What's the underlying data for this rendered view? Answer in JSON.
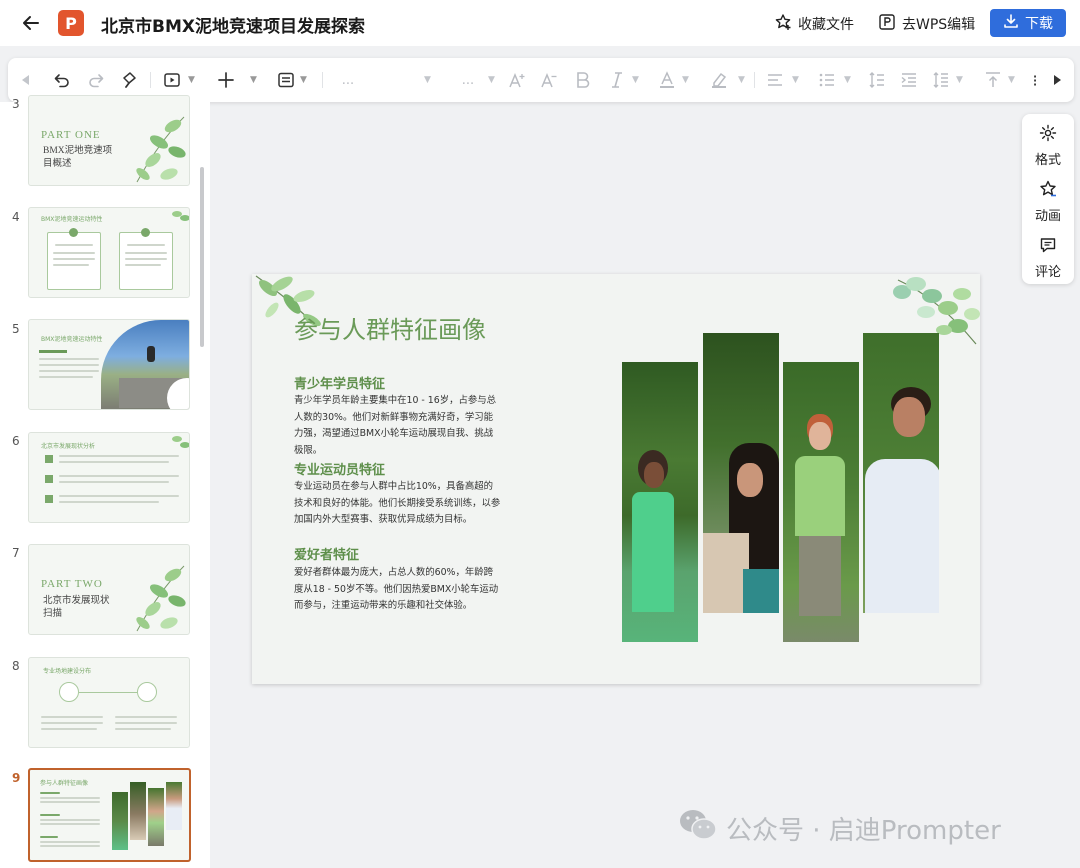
{
  "header": {
    "title": "北京市BMX泥地竞速项目发展探索",
    "app_logo_letter": "P",
    "favorite_label": "收藏文件",
    "wps_edit_label": "去WPS编辑",
    "download_label": "下载",
    "accent_color": "#2f6ddc"
  },
  "toolbar": {
    "font_name_placeholder": "...",
    "font_size_placeholder": "..."
  },
  "right_panel": {
    "format_label": "格式",
    "animation_label": "动画",
    "comment_label": "评论"
  },
  "thumbnails": [
    {
      "number": "3",
      "part_label": "PART ONE",
      "part_title": "BMX泥地竞速项目概述"
    },
    {
      "number": "4",
      "mini_title": "BMX泥地竞速运动特性"
    },
    {
      "number": "5",
      "mini_title": "BMX泥地竞速运动特性"
    },
    {
      "number": "6",
      "mini_title": "北京市发展现状分析"
    },
    {
      "number": "7",
      "part_label": "PART TWO",
      "part_title": "北京市发展现状扫描"
    },
    {
      "number": "8",
      "mini_title": "专业场地建设分布"
    },
    {
      "number": "9",
      "mini_title": "参与人群特征画像",
      "active": true
    }
  ],
  "slide": {
    "title": "参与人群特征画像",
    "sections": [
      {
        "heading": "青少年学员特征",
        "body": "青少年学员年龄主要集中在10 - 16岁，占参与总人数的30%。他们对新鲜事物充满好奇，学习能力强，渴望通过BMX小轮车运动展现自我、挑战极限。"
      },
      {
        "heading": "专业运动员特征",
        "body": "专业运动员在参与人群中占比10%，具备高超的技术和良好的体能。他们长期接受系统训练，以参加国内外大型赛事、获取优异成绩为目标。"
      },
      {
        "heading": "爱好者特征",
        "body": "爱好者群体最为庞大，占总人数的60%，年龄跨度从18 - 50岁不等。他们因热爱BMX小轮车运动而参与，注重运动带来的乐趣和社交体验。"
      }
    ],
    "title_color": "#6a9a58"
  },
  "watermark": {
    "text": "公众号 · 启迪Prompter"
  }
}
